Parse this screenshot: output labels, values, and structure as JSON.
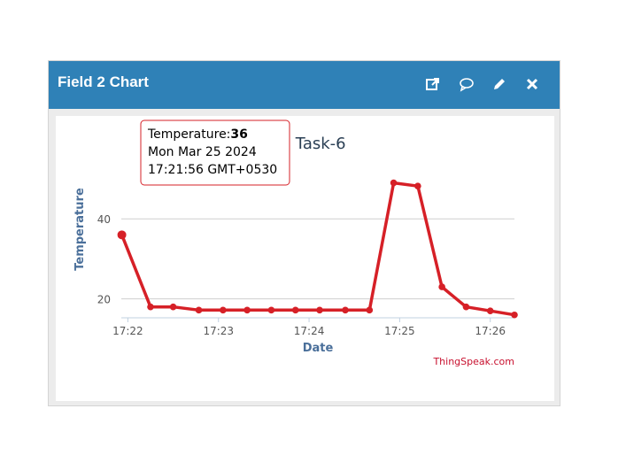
{
  "card": {
    "title": "Field 2 Chart",
    "icons": [
      "external-link-icon",
      "comment-icon",
      "edit-icon",
      "close-icon"
    ]
  },
  "colors": {
    "header": "#2f81b7",
    "series": "#d62027",
    "axis_label": "#4a6f9a",
    "credit": "#c8102e"
  },
  "chart_data": {
    "type": "line",
    "title": "Marvel Task-6",
    "xlabel": "Date",
    "ylabel": "Temperature",
    "x_ticks": [
      {
        "label": "17:22",
        "t": 0
      },
      {
        "label": "17:23",
        "t": 60
      },
      {
        "label": "17:24",
        "t": 120
      },
      {
        "label": "17:25",
        "t": 180
      },
      {
        "label": "17:26",
        "t": 240
      }
    ],
    "y_ticks": [
      20,
      40
    ],
    "xlim": [
      -2,
      256
    ],
    "ylim": [
      15.5,
      52
    ],
    "series": [
      {
        "name": "Temperature",
        "points": [
          {
            "t": -4,
            "y": 36
          },
          {
            "t": 15,
            "y": 18
          },
          {
            "t": 30,
            "y": 18
          },
          {
            "t": 47,
            "y": 17.2
          },
          {
            "t": 63,
            "y": 17.2
          },
          {
            "t": 79,
            "y": 17.2
          },
          {
            "t": 95,
            "y": 17.2
          },
          {
            "t": 111,
            "y": 17.2
          },
          {
            "t": 127,
            "y": 17.2
          },
          {
            "t": 144,
            "y": 17.2
          },
          {
            "t": 160,
            "y": 17.2
          },
          {
            "t": 176,
            "y": 49
          },
          {
            "t": 192,
            "y": 48.2
          },
          {
            "t": 208,
            "y": 23
          },
          {
            "t": 224,
            "y": 18
          },
          {
            "t": 240,
            "y": 17
          },
          {
            "t": 256,
            "y": 16
          }
        ]
      }
    ],
    "tooltip": {
      "label": "Temperature:",
      "value": "36",
      "line2": "Mon Mar 25 2024",
      "line3": "17:21:56 GMT+0530"
    },
    "credit": "ThingSpeak.com"
  }
}
